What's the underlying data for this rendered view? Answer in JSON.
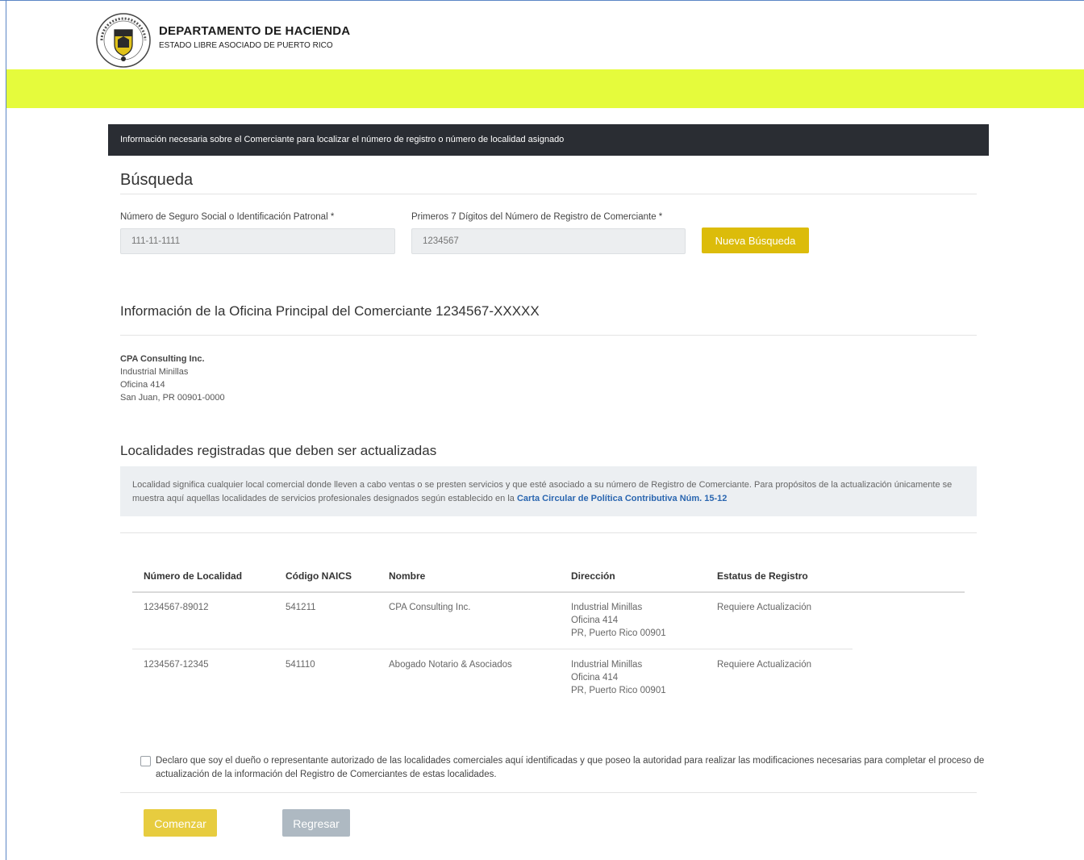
{
  "header": {
    "logo_text": "HACIENDA · LIBRE ASOCIADO DE PUERTO RICO",
    "title": "DEPARTAMENTO DE HACIENDA",
    "subtitle": "ESTADO LIBRE ASOCIADO DE PUERTO RICO"
  },
  "info_bar": "Información necesaria sobre el Comerciante para localizar el número de registro o número de localidad asignado",
  "search": {
    "title": "Búsqueda",
    "ssn_label": "Número de Seguro Social o Identificación Patronal *",
    "ssn_placeholder": "111-11-1111",
    "reg_label": "Primeros 7 Dígitos del Número de Registro de Comerciante *",
    "reg_placeholder": "1234567",
    "new_search_button": "Nueva Búsqueda"
  },
  "office": {
    "title": "Información de la Oficina Principal del Comerciante 1234567-XXXXX",
    "name": "CPA Consulting Inc.",
    "line1": "Industrial Minillas",
    "line2": "Oficina 414",
    "line3": "San Juan, PR 00901-0000"
  },
  "localities": {
    "title": "Localidades registradas que deben ser actualizadas",
    "notice_text": "Localidad significa cualquier local comercial donde lleven a cabo ventas o se presten servicios y que esté asociado a su número de Registro de Comerciante. Para propósitos de la actualización únicamente se muestra aquí aquellas localidades de servicios profesionales designados según establecido en la ",
    "notice_link": "Carta Circular de Política Contributiva Núm. 15-12",
    "columns": [
      "Número de Localidad",
      "Código NAICS",
      "Nombre",
      "Dirección",
      "Estatus de Registro"
    ],
    "rows": [
      {
        "numero": "1234567-89012",
        "naics": "541211",
        "nombre": "CPA Consulting Inc.",
        "dir1": "Industrial Minillas",
        "dir2": "Oficina 414",
        "dir3": "PR, Puerto Rico 00901",
        "estatus": "Requiere Actualización"
      },
      {
        "numero": "1234567-12345",
        "naics": "541110",
        "nombre": "Abogado Notario & Asociados",
        "dir1": "Industrial Minillas",
        "dir2": "Oficina 414",
        "dir3": "PR, Puerto Rico 00901",
        "estatus": "Requiere Actualización"
      }
    ]
  },
  "declaration": "Declaro que soy el dueño o representante autorizado de las localidades comerciales aquí identificadas y que poseo la autoridad para realizar las modificaciones necesarias para completar el proceso de actualización de la información del Registro de Comerciantes de estas localidades.",
  "actions": {
    "start": "Comenzar",
    "back": "Regresar"
  },
  "colors": {
    "accent_yellow": "#e5fb3c",
    "button_gold": "#dcbc0a",
    "info_bar_bg": "#2a2d33",
    "link_blue": "#2a66b0"
  }
}
